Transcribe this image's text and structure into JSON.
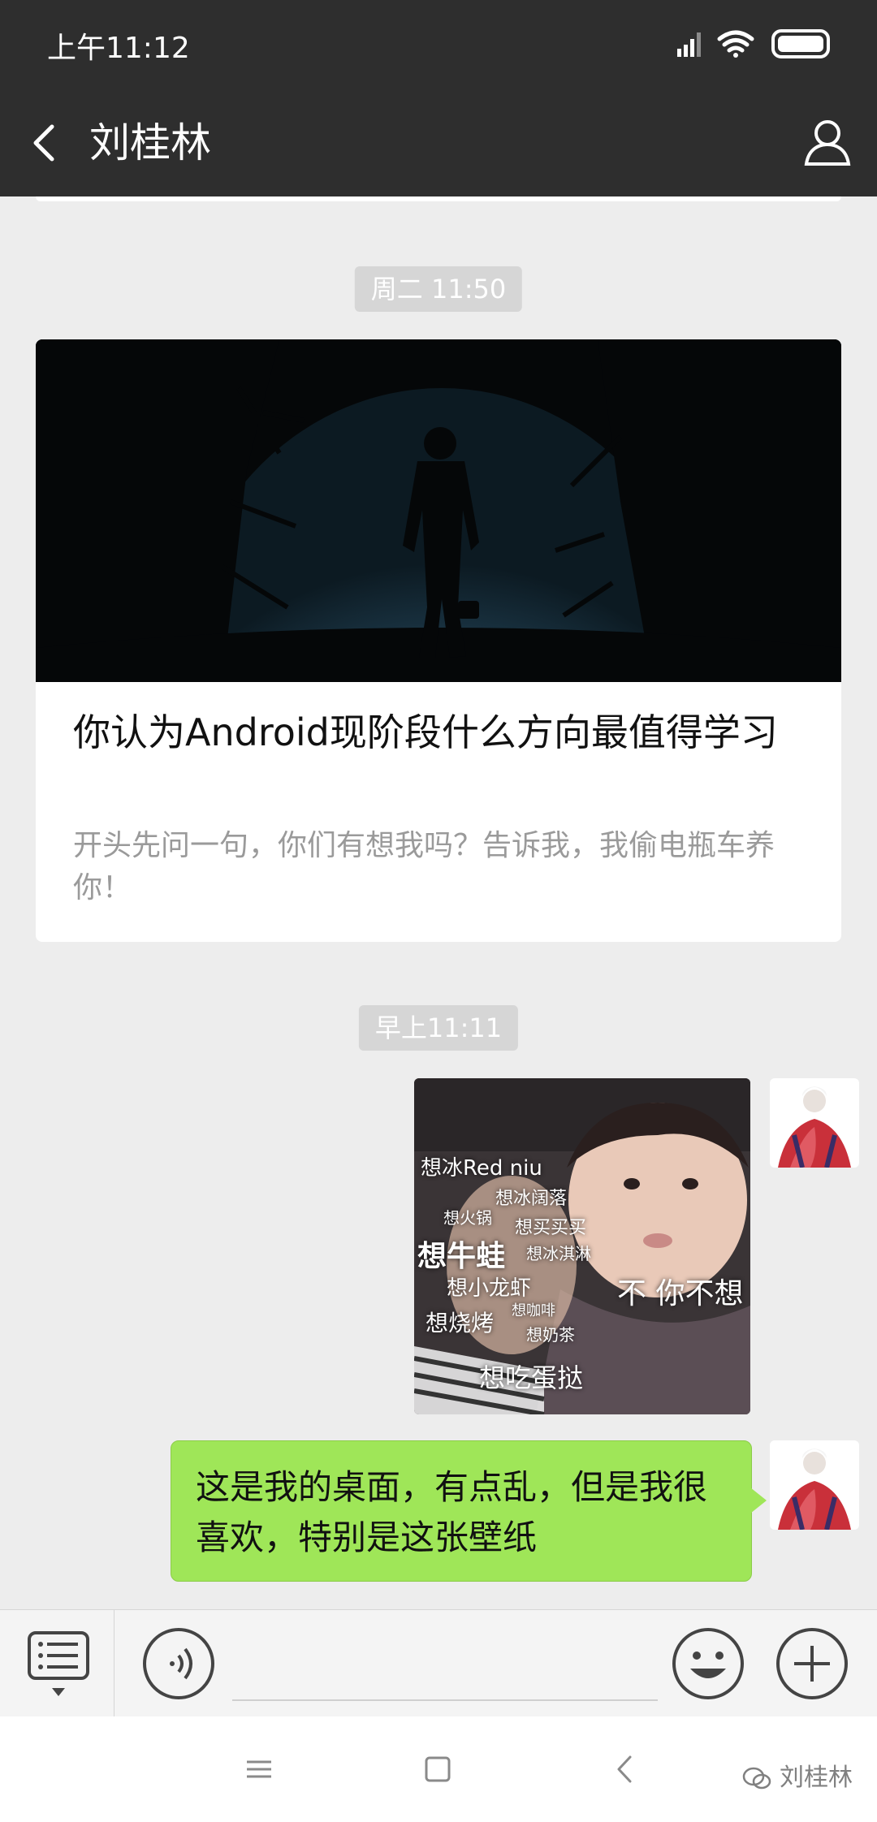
{
  "status_bar": {
    "time": "上午11:12"
  },
  "header": {
    "title": "刘桂林"
  },
  "chat": {
    "timestamp_1": "周二 11:50",
    "article": {
      "title": "你认为Android现阶段什么方向最值得学习",
      "description": "开头先问一句，你们有想我吗？告诉我，我偷电瓶车养你！"
    },
    "timestamp_2": "早上11:11",
    "meme": {
      "texts": [
        "想冰Red niu",
        "想冰阔落",
        "想火锅",
        "想买买买",
        "想牛蛙",
        "想冰淇淋",
        "想小龙虾",
        "想咖啡",
        "想烧烤",
        "想奶茶",
        "想吃蛋挞"
      ],
      "caption": "不 你不想"
    },
    "text_message": "这是我的桌面，有点乱，但是我很喜欢，特别是这张壁纸"
  },
  "input_bar": {
    "placeholder": ""
  },
  "nav_bar": {
    "watermark": "刘桂林"
  },
  "colors": {
    "header_bg": "#2e2e2e",
    "chat_bg": "#ededed",
    "bubble": "#9fe658"
  }
}
